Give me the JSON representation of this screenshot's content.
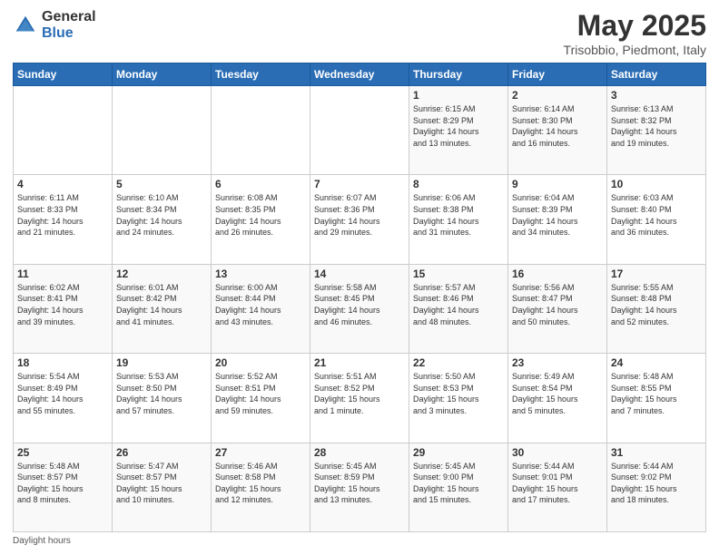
{
  "header": {
    "logo_general": "General",
    "logo_blue": "Blue",
    "title": "May 2025",
    "subtitle": "Trisobbio, Piedmont, Italy"
  },
  "days_of_week": [
    "Sunday",
    "Monday",
    "Tuesday",
    "Wednesday",
    "Thursday",
    "Friday",
    "Saturday"
  ],
  "weeks": [
    [
      {
        "day": "",
        "info": ""
      },
      {
        "day": "",
        "info": ""
      },
      {
        "day": "",
        "info": ""
      },
      {
        "day": "",
        "info": ""
      },
      {
        "day": "1",
        "info": "Sunrise: 6:15 AM\nSunset: 8:29 PM\nDaylight: 14 hours\nand 13 minutes."
      },
      {
        "day": "2",
        "info": "Sunrise: 6:14 AM\nSunset: 8:30 PM\nDaylight: 14 hours\nand 16 minutes."
      },
      {
        "day": "3",
        "info": "Sunrise: 6:13 AM\nSunset: 8:32 PM\nDaylight: 14 hours\nand 19 minutes."
      }
    ],
    [
      {
        "day": "4",
        "info": "Sunrise: 6:11 AM\nSunset: 8:33 PM\nDaylight: 14 hours\nand 21 minutes."
      },
      {
        "day": "5",
        "info": "Sunrise: 6:10 AM\nSunset: 8:34 PM\nDaylight: 14 hours\nand 24 minutes."
      },
      {
        "day": "6",
        "info": "Sunrise: 6:08 AM\nSunset: 8:35 PM\nDaylight: 14 hours\nand 26 minutes."
      },
      {
        "day": "7",
        "info": "Sunrise: 6:07 AM\nSunset: 8:36 PM\nDaylight: 14 hours\nand 29 minutes."
      },
      {
        "day": "8",
        "info": "Sunrise: 6:06 AM\nSunset: 8:38 PM\nDaylight: 14 hours\nand 31 minutes."
      },
      {
        "day": "9",
        "info": "Sunrise: 6:04 AM\nSunset: 8:39 PM\nDaylight: 14 hours\nand 34 minutes."
      },
      {
        "day": "10",
        "info": "Sunrise: 6:03 AM\nSunset: 8:40 PM\nDaylight: 14 hours\nand 36 minutes."
      }
    ],
    [
      {
        "day": "11",
        "info": "Sunrise: 6:02 AM\nSunset: 8:41 PM\nDaylight: 14 hours\nand 39 minutes."
      },
      {
        "day": "12",
        "info": "Sunrise: 6:01 AM\nSunset: 8:42 PM\nDaylight: 14 hours\nand 41 minutes."
      },
      {
        "day": "13",
        "info": "Sunrise: 6:00 AM\nSunset: 8:44 PM\nDaylight: 14 hours\nand 43 minutes."
      },
      {
        "day": "14",
        "info": "Sunrise: 5:58 AM\nSunset: 8:45 PM\nDaylight: 14 hours\nand 46 minutes."
      },
      {
        "day": "15",
        "info": "Sunrise: 5:57 AM\nSunset: 8:46 PM\nDaylight: 14 hours\nand 48 minutes."
      },
      {
        "day": "16",
        "info": "Sunrise: 5:56 AM\nSunset: 8:47 PM\nDaylight: 14 hours\nand 50 minutes."
      },
      {
        "day": "17",
        "info": "Sunrise: 5:55 AM\nSunset: 8:48 PM\nDaylight: 14 hours\nand 52 minutes."
      }
    ],
    [
      {
        "day": "18",
        "info": "Sunrise: 5:54 AM\nSunset: 8:49 PM\nDaylight: 14 hours\nand 55 minutes."
      },
      {
        "day": "19",
        "info": "Sunrise: 5:53 AM\nSunset: 8:50 PM\nDaylight: 14 hours\nand 57 minutes."
      },
      {
        "day": "20",
        "info": "Sunrise: 5:52 AM\nSunset: 8:51 PM\nDaylight: 14 hours\nand 59 minutes."
      },
      {
        "day": "21",
        "info": "Sunrise: 5:51 AM\nSunset: 8:52 PM\nDaylight: 15 hours\nand 1 minute."
      },
      {
        "day": "22",
        "info": "Sunrise: 5:50 AM\nSunset: 8:53 PM\nDaylight: 15 hours\nand 3 minutes."
      },
      {
        "day": "23",
        "info": "Sunrise: 5:49 AM\nSunset: 8:54 PM\nDaylight: 15 hours\nand 5 minutes."
      },
      {
        "day": "24",
        "info": "Sunrise: 5:48 AM\nSunset: 8:55 PM\nDaylight: 15 hours\nand 7 minutes."
      }
    ],
    [
      {
        "day": "25",
        "info": "Sunrise: 5:48 AM\nSunset: 8:57 PM\nDaylight: 15 hours\nand 8 minutes."
      },
      {
        "day": "26",
        "info": "Sunrise: 5:47 AM\nSunset: 8:57 PM\nDaylight: 15 hours\nand 10 minutes."
      },
      {
        "day": "27",
        "info": "Sunrise: 5:46 AM\nSunset: 8:58 PM\nDaylight: 15 hours\nand 12 minutes."
      },
      {
        "day": "28",
        "info": "Sunrise: 5:45 AM\nSunset: 8:59 PM\nDaylight: 15 hours\nand 13 minutes."
      },
      {
        "day": "29",
        "info": "Sunrise: 5:45 AM\nSunset: 9:00 PM\nDaylight: 15 hours\nand 15 minutes."
      },
      {
        "day": "30",
        "info": "Sunrise: 5:44 AM\nSunset: 9:01 PM\nDaylight: 15 hours\nand 17 minutes."
      },
      {
        "day": "31",
        "info": "Sunrise: 5:44 AM\nSunset: 9:02 PM\nDaylight: 15 hours\nand 18 minutes."
      }
    ]
  ],
  "footer": {
    "daylight_label": "Daylight hours"
  }
}
